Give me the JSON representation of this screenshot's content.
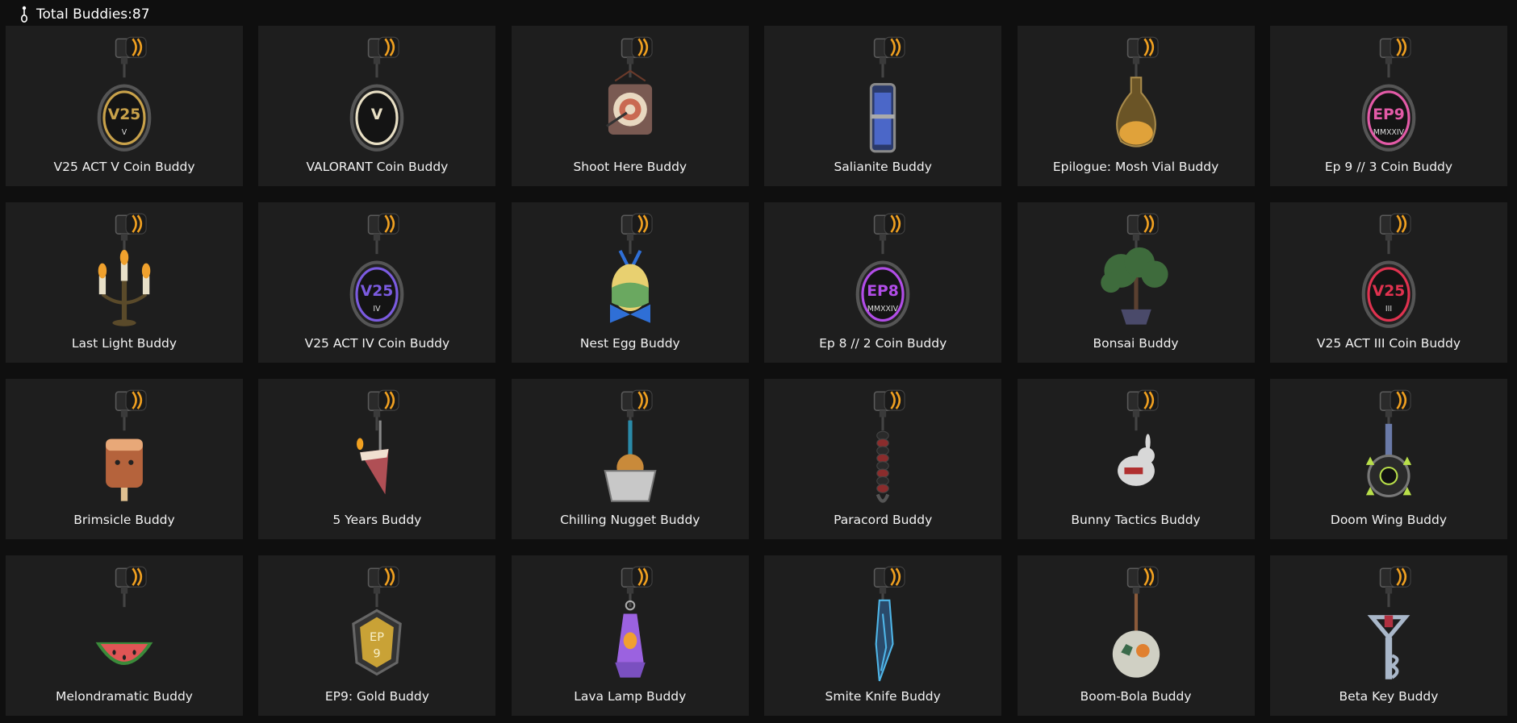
{
  "header": {
    "label": "Total Buddies:87",
    "icon": "buddy-icon"
  },
  "buddies": [
    {
      "name": "V25 ACT V Coin Buddy",
      "kind": "coin",
      "color": "#c9a24a",
      "text": "V25",
      "sub": "V"
    },
    {
      "name": "VALORANT Coin Buddy",
      "kind": "coin",
      "color": "#e8dfc4",
      "text": "V",
      "sub": ""
    },
    {
      "name": "Shoot Here Buddy",
      "kind": "target",
      "color": "#c96a52"
    },
    {
      "name": "Salianite Buddy",
      "kind": "vial",
      "color": "#4b67c8"
    },
    {
      "name": "Epilogue: Mosh Vial Buddy",
      "kind": "flask",
      "color": "#e0a23a"
    },
    {
      "name": "Ep 9 // 3 Coin Buddy",
      "kind": "coin",
      "color": "#e35aa7",
      "text": "EP9",
      "sub": "MMXXIV"
    },
    {
      "name": "Last Light Buddy",
      "kind": "candle",
      "color": "#f0a12d"
    },
    {
      "name": "V25 ACT IV Coin Buddy",
      "kind": "coin",
      "color": "#7b5be0",
      "text": "V25",
      "sub": "IV"
    },
    {
      "name": "Nest Egg Buddy",
      "kind": "egg",
      "color": "#2f6fd6"
    },
    {
      "name": "Ep 8 // 2 Coin Buddy",
      "kind": "coin",
      "color": "#b24de8",
      "text": "EP8",
      "sub": "MMXXIV"
    },
    {
      "name": "Bonsai Buddy",
      "kind": "tree",
      "color": "#3e6b3c"
    },
    {
      "name": "V25 ACT III Coin Buddy",
      "kind": "coin",
      "color": "#e0324f",
      "text": "V25",
      "sub": "III"
    },
    {
      "name": "Brimsicle Buddy",
      "kind": "popsicle",
      "color": "#b5633c"
    },
    {
      "name": "5 Years Buddy",
      "kind": "cake",
      "color": "#b04f55"
    },
    {
      "name": "Chilling Nugget Buddy",
      "kind": "tub",
      "color": "#c8c8c8"
    },
    {
      "name": "Paracord Buddy",
      "kind": "cord",
      "color": "#8a2c2c"
    },
    {
      "name": "Bunny Tactics Buddy",
      "kind": "bunny",
      "color": "#d8d8d8"
    },
    {
      "name": "Doom Wing Buddy",
      "kind": "wing",
      "color": "#b9e04a"
    },
    {
      "name": "Melondramatic Buddy",
      "kind": "melon",
      "color": "#e05555"
    },
    {
      "name": "EP9: Gold Buddy",
      "kind": "badge",
      "color": "#c9a236",
      "text": "EP",
      "sub": "9"
    },
    {
      "name": "Lava Lamp Buddy",
      "kind": "lamp",
      "color": "#9b62e0"
    },
    {
      "name": "Smite Knife Buddy",
      "kind": "knife",
      "color": "#4fb6e8"
    },
    {
      "name": "Boom-Bola Buddy",
      "kind": "ball",
      "color": "#d0d0c4"
    },
    {
      "name": "Beta Key Buddy",
      "kind": "key",
      "color": "#a9b7c9"
    }
  ]
}
